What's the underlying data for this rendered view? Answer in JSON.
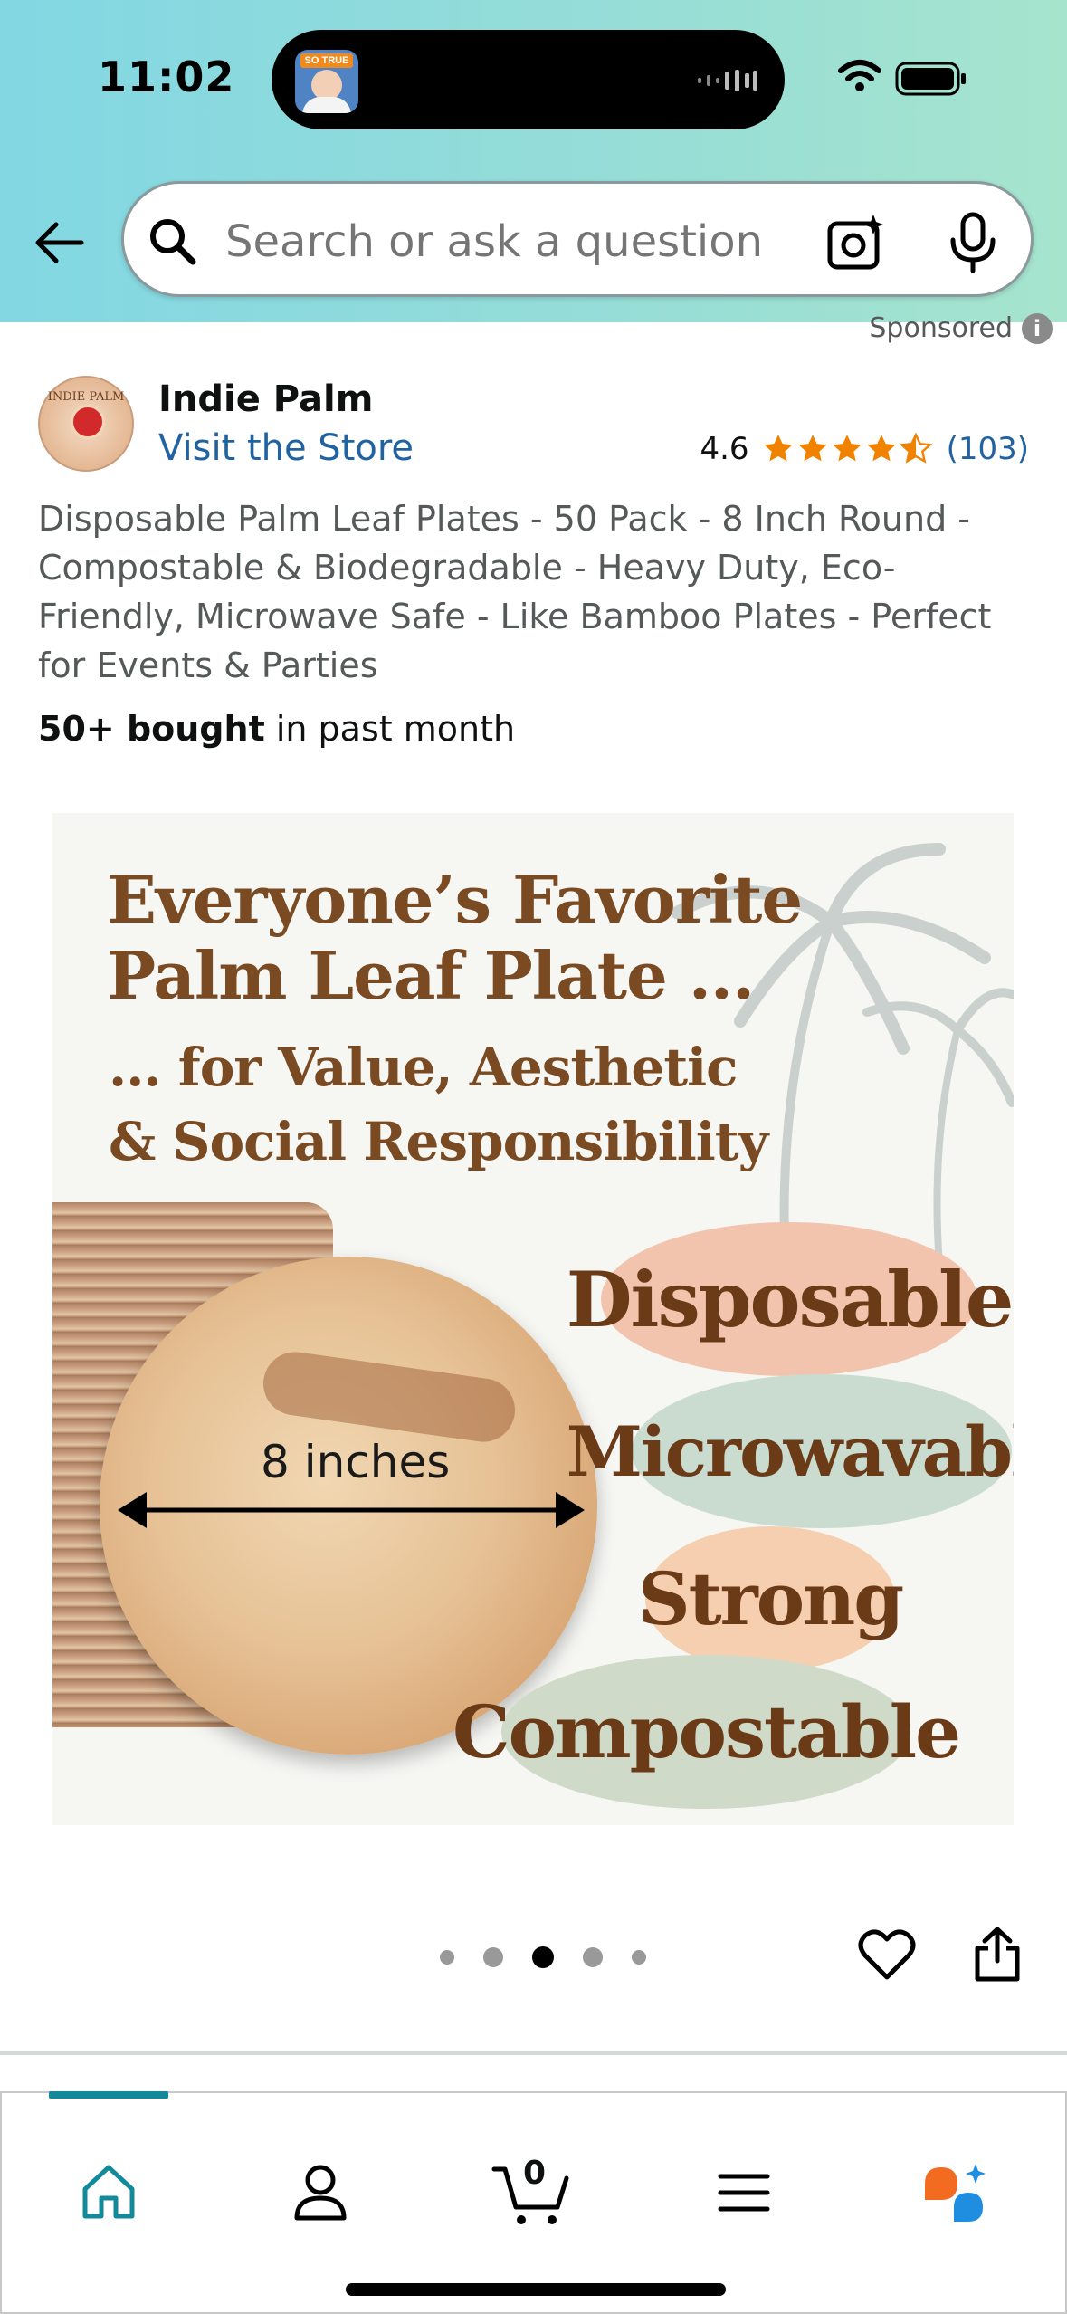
{
  "status_bar": {
    "time": "11:02",
    "island_app_badge": "SO TRUE"
  },
  "search": {
    "placeholder": "Search or ask a question",
    "icons": [
      "back-arrow-icon",
      "search-icon",
      "camera-icon",
      "microphone-icon"
    ]
  },
  "sponsored_label": "Sponsored",
  "store": {
    "name": "Indie Palm",
    "visit_label": "Visit the Store",
    "logo_text": "INDIE PALM",
    "rating": "4.6",
    "stars_value": 4.5,
    "rating_count": "(103)"
  },
  "product": {
    "title": "Disposable Palm Leaf Plates - 50 Pack - 8 Inch Round - Compostable & Biodegradable - Heavy Duty, Eco-Friendly, Microwave Safe - Like Bamboo Plates - Perfect for Events & Parties",
    "bought_strong": "50+ bought",
    "bought_rest": " in past month"
  },
  "image": {
    "headline_line1": "Everyone’s Favorite",
    "headline_line2": "Palm Leaf Plate ...",
    "subhead_line1": "... for Value, Aesthetic",
    "subhead_line2": "& Social Responsibility",
    "measure_label": "8 inches",
    "features": [
      "Disposable",
      "Microwavable",
      "Strong",
      "Compostable"
    ],
    "feature_colors": [
      "#f3c4ad",
      "#c9dccf",
      "#f5cfb0",
      "#cfdbc8"
    ]
  },
  "carousel": {
    "total": 5,
    "active_index": 2
  },
  "bottom_nav": {
    "cart_count": "0",
    "items": [
      "home-icon",
      "account-icon",
      "cart-icon",
      "menu-icon",
      "rufus-icon"
    ],
    "accent_color": "#138a9a"
  }
}
